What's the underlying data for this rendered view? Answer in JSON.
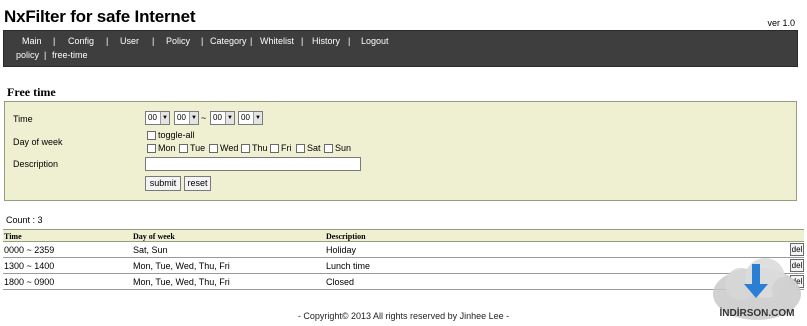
{
  "app": {
    "title": "NxFilter for safe Internet",
    "version": "ver 1.0"
  },
  "nav": {
    "row1": [
      "Main",
      "Config",
      "User",
      "Policy",
      "Category",
      "Whitelist",
      "History",
      "Logout"
    ],
    "row2": [
      "policy",
      "free-time"
    ]
  },
  "form": {
    "title": "Free time",
    "time_label": "Time",
    "dow_label": "Day of week",
    "desc_label": "Description",
    "time_from_hour": "00",
    "time_from_min": "00",
    "time_sep": "~",
    "time_to_hour": "00",
    "time_to_min": "00",
    "toggle_all": "toggle-all",
    "days": [
      "Mon",
      "Tue",
      "Wed",
      "Thu",
      "Fri",
      "Sat",
      "Sun"
    ],
    "description_value": "",
    "submit_label": "submit",
    "reset_label": "reset"
  },
  "list": {
    "count_text": "Count : 3",
    "headers": [
      "Time",
      "Day of week",
      "Description"
    ],
    "rows": [
      {
        "time": "0000 ~ 2359",
        "dow": "Sat, Sun",
        "desc": "Holiday",
        "action": "del"
      },
      {
        "time": "1300 ~ 1400",
        "dow": "Mon, Tue, Wed, Thu, Fri",
        "desc": "Lunch time",
        "action": "del"
      },
      {
        "time": "1800 ~ 0900",
        "dow": "Mon, Tue, Wed, Thu, Fri",
        "desc": "Closed",
        "action": "del"
      }
    ]
  },
  "footer": {
    "text": "- Copyright© 2013 All rights reserved by Jinhee Lee -"
  },
  "watermark": {
    "text": "İNDİRSON.COM",
    "icon": "cloud-download-icon",
    "accent": "#2a7fd4"
  }
}
